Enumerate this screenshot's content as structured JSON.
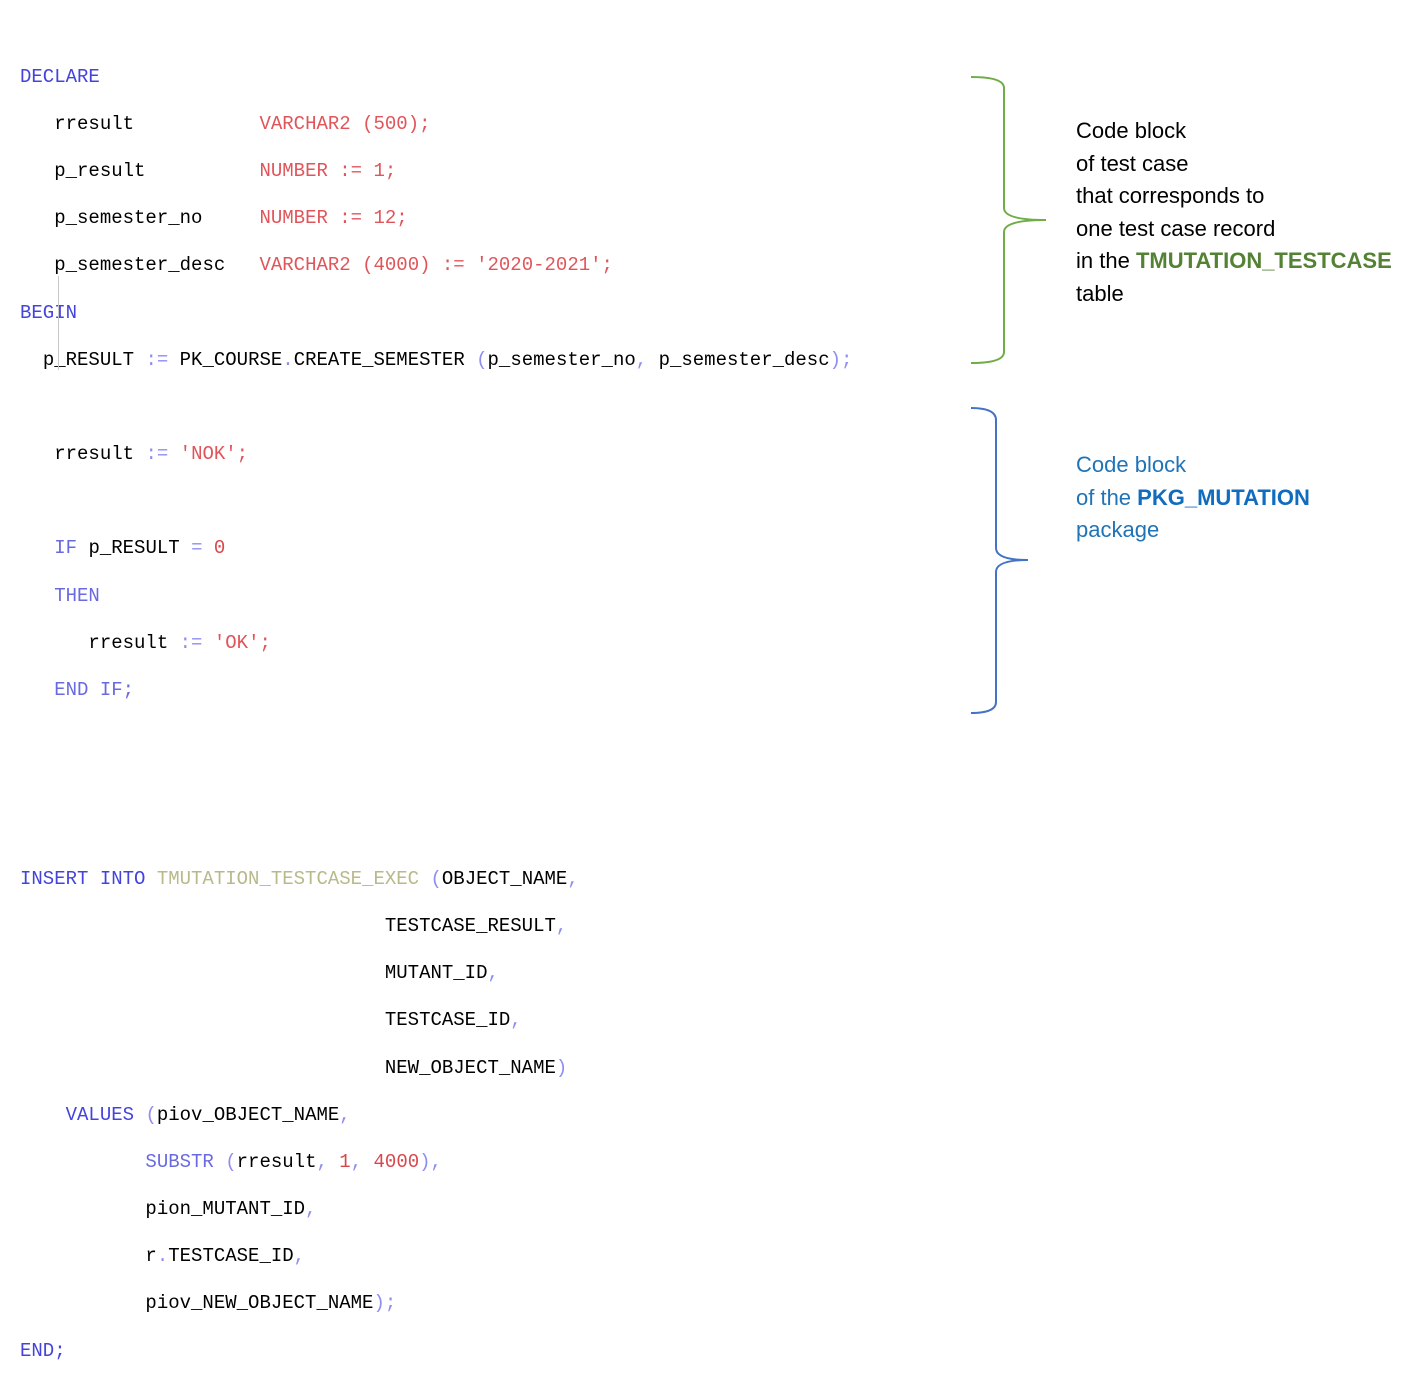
{
  "code_block_1": {
    "declare": "DECLARE",
    "var1_name": "rresult",
    "var1_type": "VARCHAR2 (500);",
    "var2_name": "p_result",
    "var2_type": "NUMBER := 1;",
    "var3_name": "p_semester_no",
    "var3_type": "NUMBER := 12;",
    "var4_name": "p_semester_desc",
    "var4_type": "VARCHAR2 (4000) := '2020-2021';",
    "begin": "BEGIN",
    "call_target": "p_RESULT",
    "call_assign": ":=",
    "call_function": "PK_COURSE",
    "call_dot": ".",
    "call_method": "CREATE_SEMESTER",
    "call_open": "(",
    "call_arg1": "p_semester_no",
    "call_comma": ",",
    "call_arg2": "p_semester_desc",
    "call_close": ");",
    "nok_var": "rresult",
    "nok_assign": ":=",
    "nok_value": "'NOK';",
    "if_kw": "IF",
    "if_cond": "p_RESULT",
    "if_eq": "=",
    "if_val": "0",
    "then_kw": "THEN",
    "ok_var": "rresult",
    "ok_assign": ":=",
    "ok_value": "'OK';",
    "endif_kw": "END IF;"
  },
  "code_block_2": {
    "insert_kw": "INSERT INTO",
    "table_name": "TMUTATION_TESTCASE_EXEC",
    "open_paren": "(",
    "col1": "OBJECT_NAME",
    "col2": "TESTCASE_RESULT",
    "col3": "MUTANT_ID",
    "col4": "TESTCASE_ID",
    "col5": "NEW_OBJECT_NAME",
    "comma": ",",
    "close_paren": ")",
    "values_kw": "VALUES",
    "val1": "piov_OBJECT_NAME",
    "substr_kw": "SUBSTR",
    "substr_arg": "rresult",
    "substr_n1": "1",
    "substr_n2": "4000",
    "val3": "pion_MUTANT_ID",
    "val4_prefix": "r",
    "val4_dot": ".",
    "val4": "TESTCASE_ID",
    "val5": "piov_NEW_OBJECT_NAME",
    "end_close": ");",
    "end_kw": "END;"
  },
  "annotation_1": {
    "line1": "Code block",
    "line2": "of test case",
    "line3": "that corresponds to",
    "line4": "one test case record",
    "line5_prefix": "in the ",
    "line5_bold": "TMUTATION_TESTCASE",
    "line6": "table"
  },
  "annotation_2": {
    "line1": "Code block",
    "line2_prefix": "of the ",
    "line2_bold": "PKG_MUTATION",
    "line3": "package"
  },
  "colors": {
    "brace_1": "#70ad47",
    "brace_2": "#4472c4"
  }
}
